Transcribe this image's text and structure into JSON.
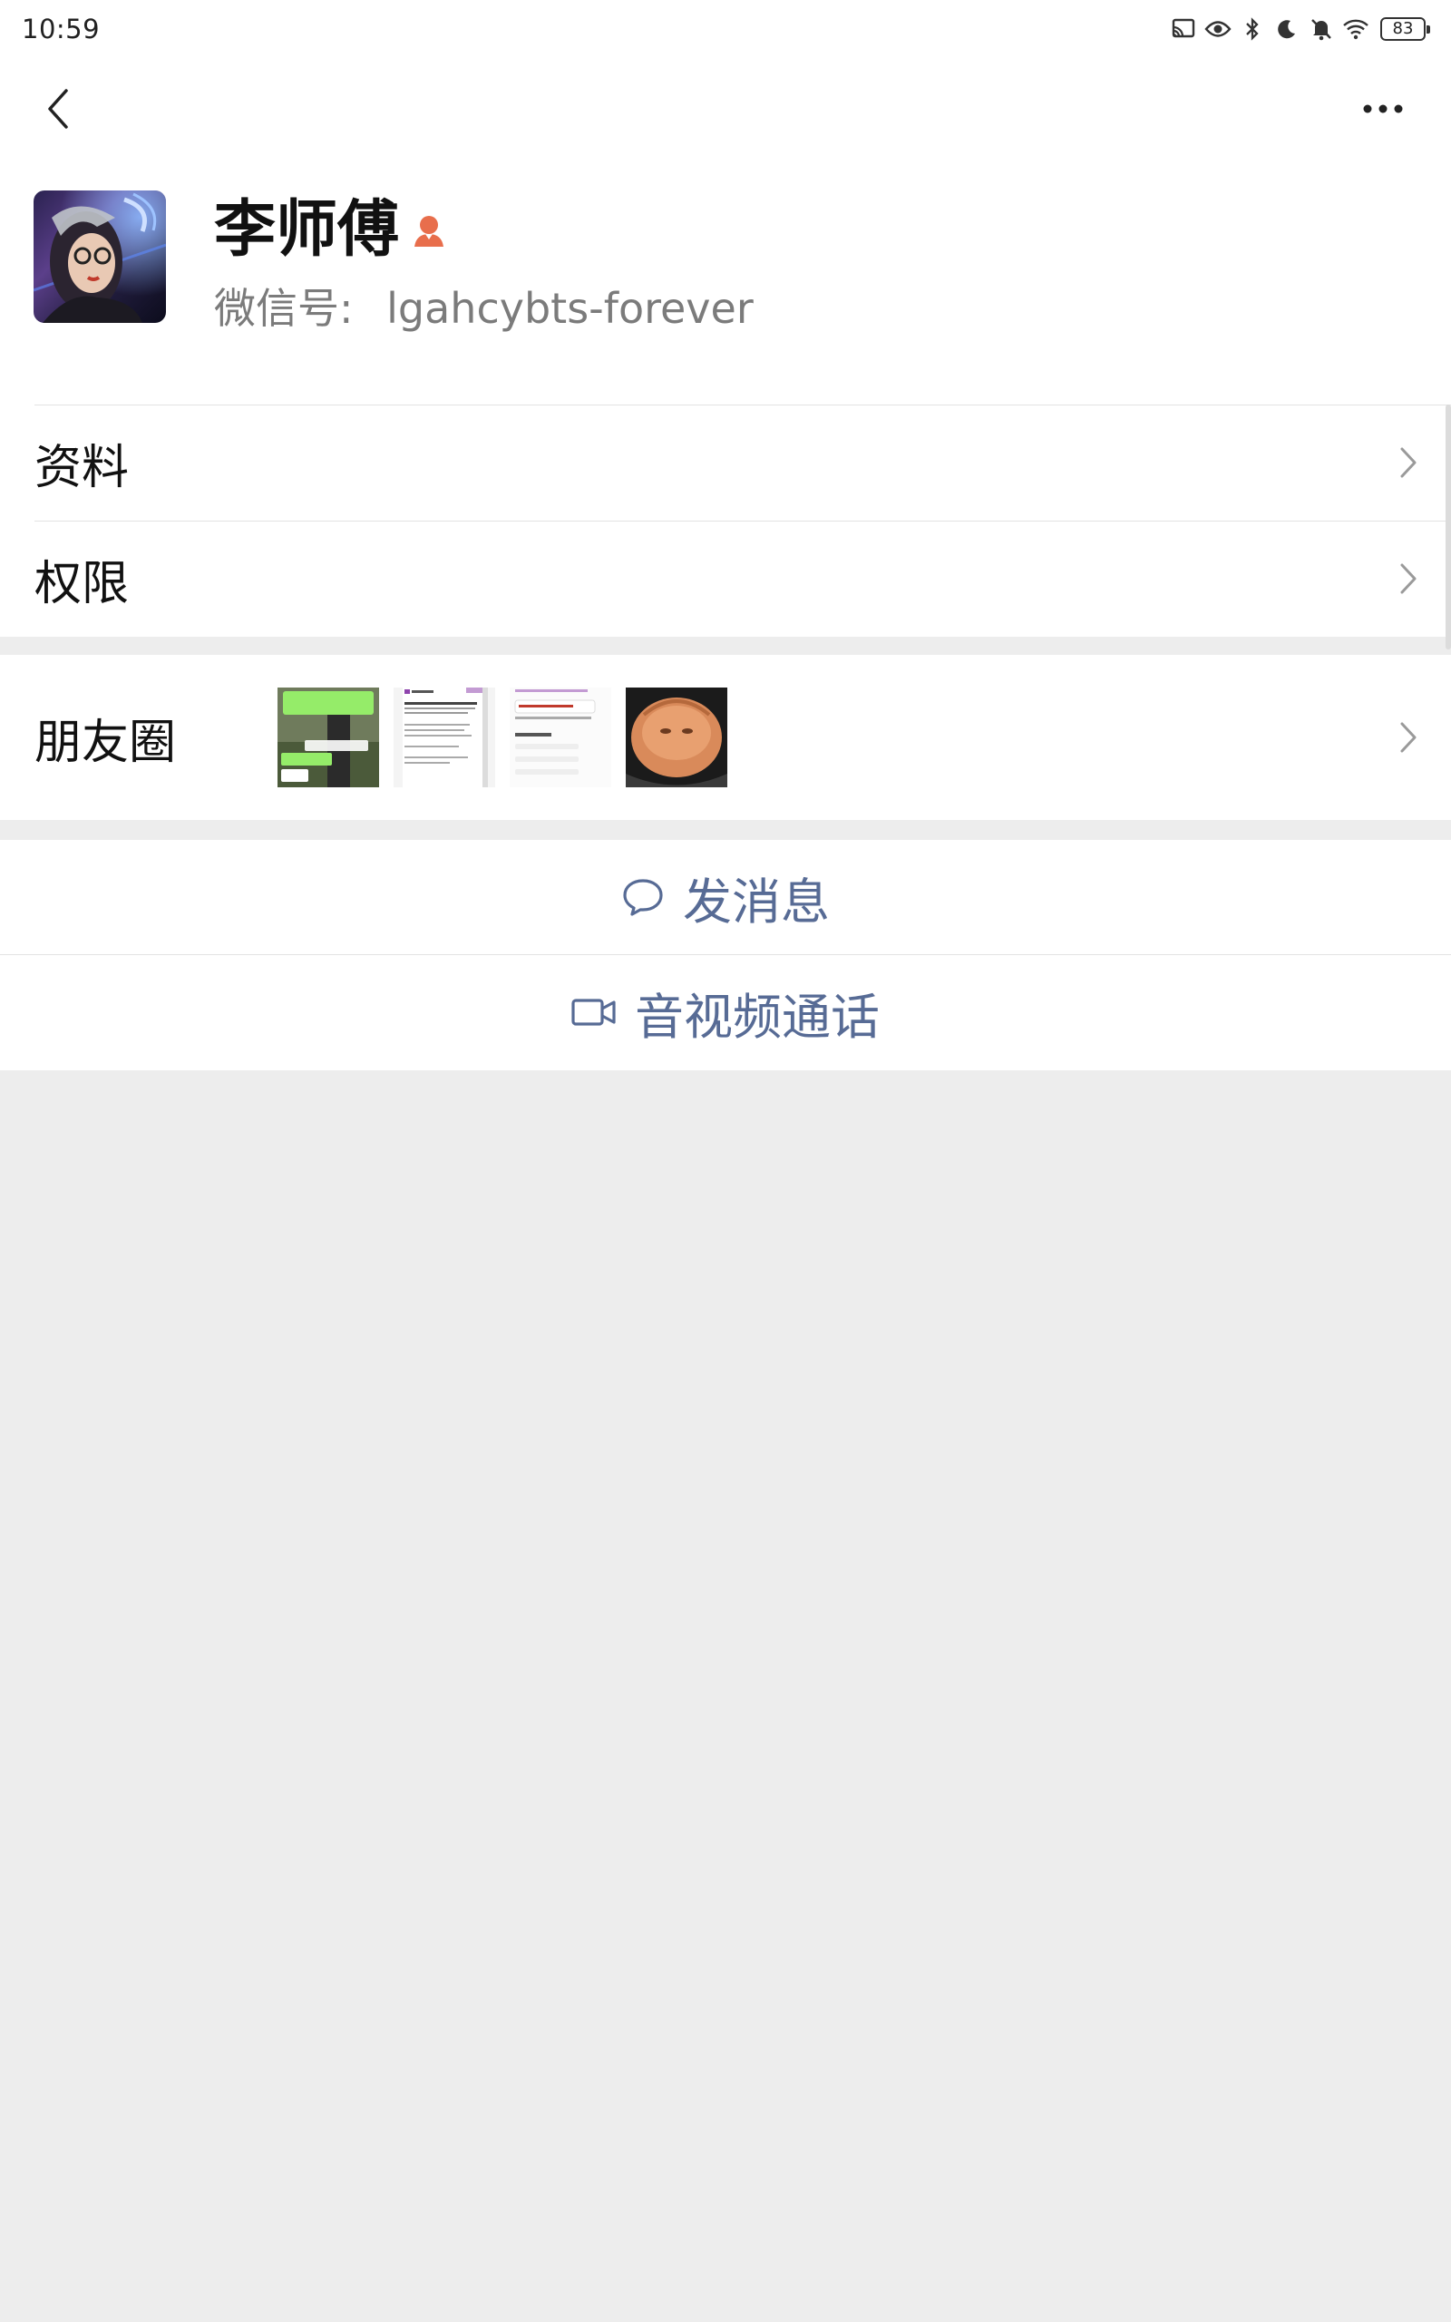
{
  "status_bar": {
    "time": "10:59",
    "battery": "83",
    "icons": [
      "cast-icon",
      "eye-icon",
      "bluetooth-icon",
      "moon-icon",
      "mute-icon",
      "wifi-icon"
    ]
  },
  "nav": {
    "back_icon": "chevron-left-icon",
    "more_icon": "more-dots-icon"
  },
  "profile": {
    "name": "李师傅",
    "wechat_id_label": "微信号:",
    "wechat_id": "lgahcybts-forever",
    "badge_color": "#e86e4c"
  },
  "rows": {
    "profile_label": "资料",
    "permission_label": "权限",
    "moments_label": "朋友圈"
  },
  "actions": {
    "send_message": "发消息",
    "av_call": "音视频通话"
  },
  "colors": {
    "link_blue": "#576b95",
    "background": "#ededed"
  }
}
